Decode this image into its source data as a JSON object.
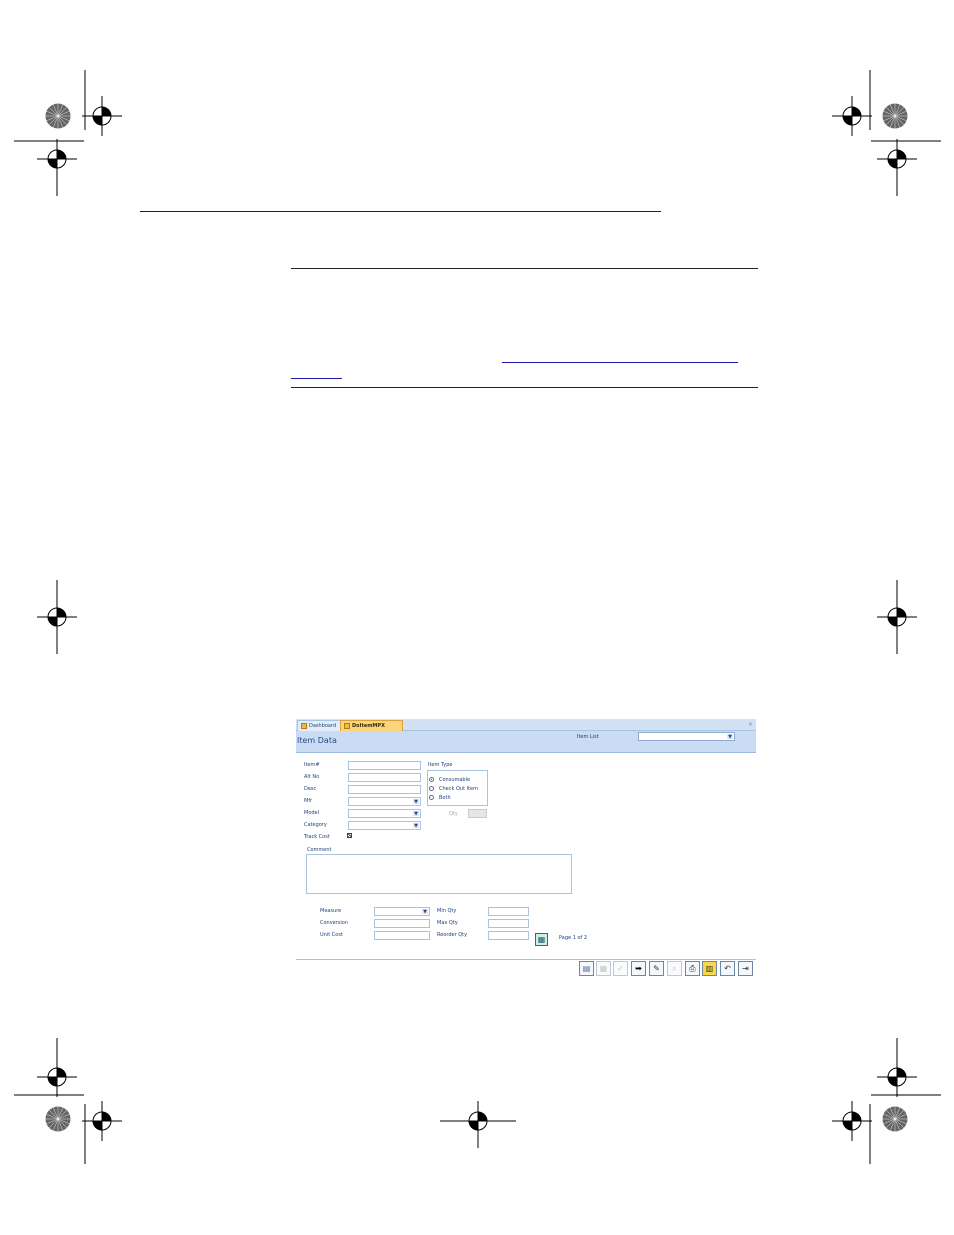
{
  "tabs": [
    {
      "label": "Dashboard",
      "active": false
    },
    {
      "label": "DoItemMPX",
      "active": true
    }
  ],
  "tab_close": "×",
  "form": {
    "title": "Item Data",
    "item_list_label": "Item List",
    "item_list_value": "",
    "fields": {
      "item_no": "Item#",
      "alt_no": "Alt No",
      "desc": "Desc",
      "mfr": "Mfr",
      "model": "Model",
      "category": "Category",
      "track_cost": "Track Cost"
    },
    "item_type": {
      "label": "Item Type",
      "options": [
        "Consumable",
        "Check Out Item",
        "Both"
      ],
      "selected": "Consumable"
    },
    "qty_label": "Qty",
    "comment_label": "Comment",
    "measure_label": "Measure",
    "conversion_label": "Conversion",
    "unit_cost_label": "Unit Cost",
    "min_qty_label": "Min Qty",
    "max_qty_label": "Max Qty",
    "reorder_qty_label": "Reorder Qty",
    "page_indicator": "Page 1 of 2",
    "dropdown_arrow": "▼"
  },
  "toolbar": [
    {
      "name": "new-record-icon",
      "glyph": "▤",
      "enabled": true
    },
    {
      "name": "table-icon",
      "glyph": "▦",
      "enabled": false
    },
    {
      "name": "checkmark-icon",
      "glyph": "✓",
      "enabled": false
    },
    {
      "name": "arrow-right-icon",
      "glyph": "➡",
      "enabled": true
    },
    {
      "name": "edit-icon",
      "glyph": "✎",
      "enabled": true
    },
    {
      "name": "find-icon",
      "glyph": "⌕",
      "enabled": false
    },
    {
      "name": "print-icon",
      "glyph": "⎙",
      "enabled": true
    },
    {
      "name": "delete-icon",
      "glyph": "▥",
      "enabled": true
    },
    {
      "name": "undo-icon",
      "glyph": "↶",
      "enabled": true
    },
    {
      "name": "exit-icon",
      "glyph": "⇥",
      "enabled": true
    }
  ],
  "colors": {
    "header_bg": "#c9dcf3",
    "tab_active": "#fbd57d",
    "label_text": "#1f3f7a",
    "field_border": "#a9c3e3"
  }
}
